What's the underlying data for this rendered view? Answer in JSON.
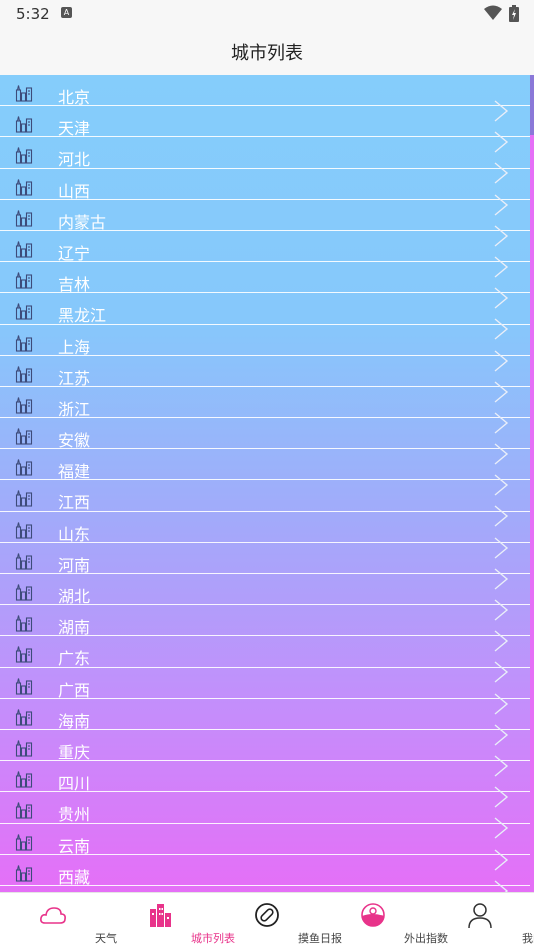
{
  "status": {
    "time": "5:32",
    "notification_glyph": "A"
  },
  "header": {
    "title": "城市列表"
  },
  "cities": [
    "北京",
    "天津",
    "河北",
    "山西",
    "内蒙古",
    "辽宁",
    "吉林",
    "黑龙江",
    "上海",
    "江苏",
    "浙江",
    "安徽",
    "福建",
    "江西",
    "山东",
    "河南",
    "湖北",
    "湖南",
    "广东",
    "广西",
    "海南",
    "重庆",
    "四川",
    "贵州",
    "云南",
    "西藏",
    ""
  ],
  "tabs": [
    {
      "label": "天气",
      "icon": "cloud-icon"
    },
    {
      "label": "城市列表",
      "icon": "city-buildings-icon",
      "active": true
    },
    {
      "label": "摸鱼日报",
      "icon": "bandage-icon"
    },
    {
      "label": "外出指数",
      "icon": "sun-horizon-icon"
    },
    {
      "label": "我的",
      "icon": "person-icon"
    }
  ],
  "colors": {
    "accent": "#e8338a",
    "list_top": "#85cdfb",
    "list_bottom": "#e56ff7"
  }
}
